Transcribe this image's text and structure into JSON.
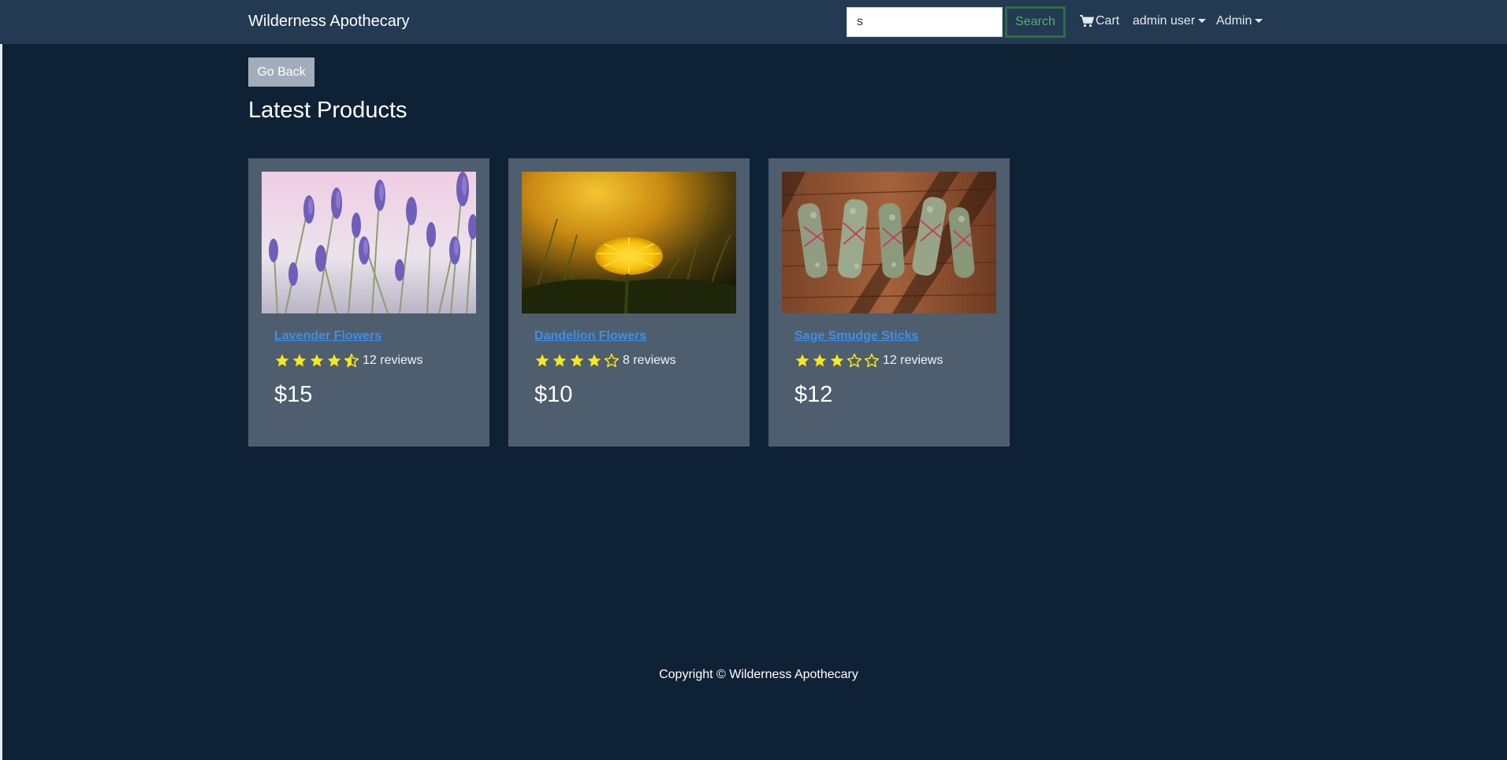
{
  "header": {
    "brand": "Wilderness Apothecary",
    "search_value": "s",
    "search_button": "Search",
    "cart_label": "Cart",
    "user_menu_label": "admin user",
    "admin_menu_label": "Admin"
  },
  "main": {
    "go_back_label": "Go Back",
    "heading": "Latest Products"
  },
  "products": [
    {
      "name": "Lavender Flowers",
      "rating": 4.5,
      "reviews_text": "12 reviews",
      "price": "$15",
      "image": "lavender-photo"
    },
    {
      "name": "Dandelion Flowers",
      "rating": 4,
      "reviews_text": "8 reviews",
      "price": "$10",
      "image": "dandelion-photo"
    },
    {
      "name": "Sage Smudge Sticks",
      "rating": 3,
      "reviews_text": "12 reviews",
      "price": "$12",
      "image": "sage-sticks-photo"
    }
  ],
  "footer": {
    "copyright": "Copyright © Wilderness Apothecary"
  },
  "colors": {
    "background": "#0f2235",
    "navbar": "#233a52",
    "card": "#4e5e6f",
    "link": "#3d8fe8",
    "star": "#f8e71c",
    "search_button": "#4fb06f"
  },
  "icons": {
    "cart": "cart-icon",
    "star_full": "star-full-icon",
    "star_half": "star-half-icon",
    "star_empty": "star-empty-icon"
  }
}
